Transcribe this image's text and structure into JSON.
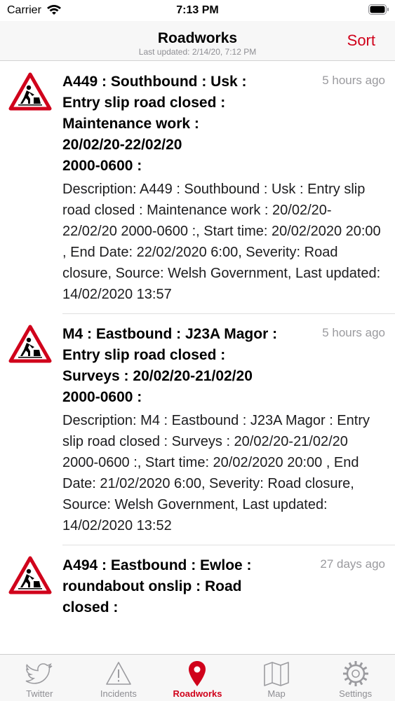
{
  "status_bar": {
    "carrier": "Carrier",
    "time": "7:13 PM"
  },
  "nav": {
    "title": "Roadworks",
    "subtitle": "Last updated: 2/14/20, 7:12 PM",
    "sort_label": "Sort"
  },
  "items": [
    {
      "title_lines": [
        "A449 : Southbound : Usk :",
        "Entry slip road closed :",
        "Maintenance work :",
        "20/02/20-22/02/20",
        "2000-0600 :"
      ],
      "time_ago": "5 hours ago",
      "description": "Description: A449 : Southbound : Usk : Entry slip road closed : Maintenance work : 20/02/20-22/02/20 2000-0600 :, Start time: 20/02/2020 20:00 , End Date: 22/02/2020 6:00, Severity: Road closure, Source: Welsh Government, Last updated: 14/02/2020 13:57",
      "icon": "roadworks-warning-icon"
    },
    {
      "title_lines": [
        "M4 : Eastbound : J23A Magor :",
        "Entry slip road closed :",
        "Surveys : 20/02/20-21/02/20",
        "2000-0600 :"
      ],
      "time_ago": "5 hours ago",
      "description": "Description: M4 : Eastbound : J23A Magor : Entry slip road closed : Surveys : 20/02/20-21/02/20 2000-0600 :, Start time: 20/02/2020 20:00 , End Date: 21/02/2020 6:00, Severity: Road closure, Source: Welsh Government, Last updated: 14/02/2020 13:52",
      "icon": "roadworks-warning-icon"
    },
    {
      "title_lines": [
        "A494 : Eastbound : Ewloe :",
        "roundabout onslip : Road",
        "closed :"
      ],
      "time_ago": "27 days ago",
      "description": "",
      "icon": "roadworks-warning-icon"
    }
  ],
  "tabs": [
    {
      "label": "Twitter",
      "icon": "twitter-bird-icon",
      "active": false
    },
    {
      "label": "Incidents",
      "icon": "warning-triangle-icon",
      "active": false
    },
    {
      "label": "Roadworks",
      "icon": "map-pin-icon",
      "active": true
    },
    {
      "label": "Map",
      "icon": "folded-map-icon",
      "active": false
    },
    {
      "label": "Settings",
      "icon": "gear-icon",
      "active": false
    }
  ],
  "colors": {
    "accent": "#d0021b",
    "inactive": "#8e8e93",
    "warning_red": "#d0021b"
  }
}
